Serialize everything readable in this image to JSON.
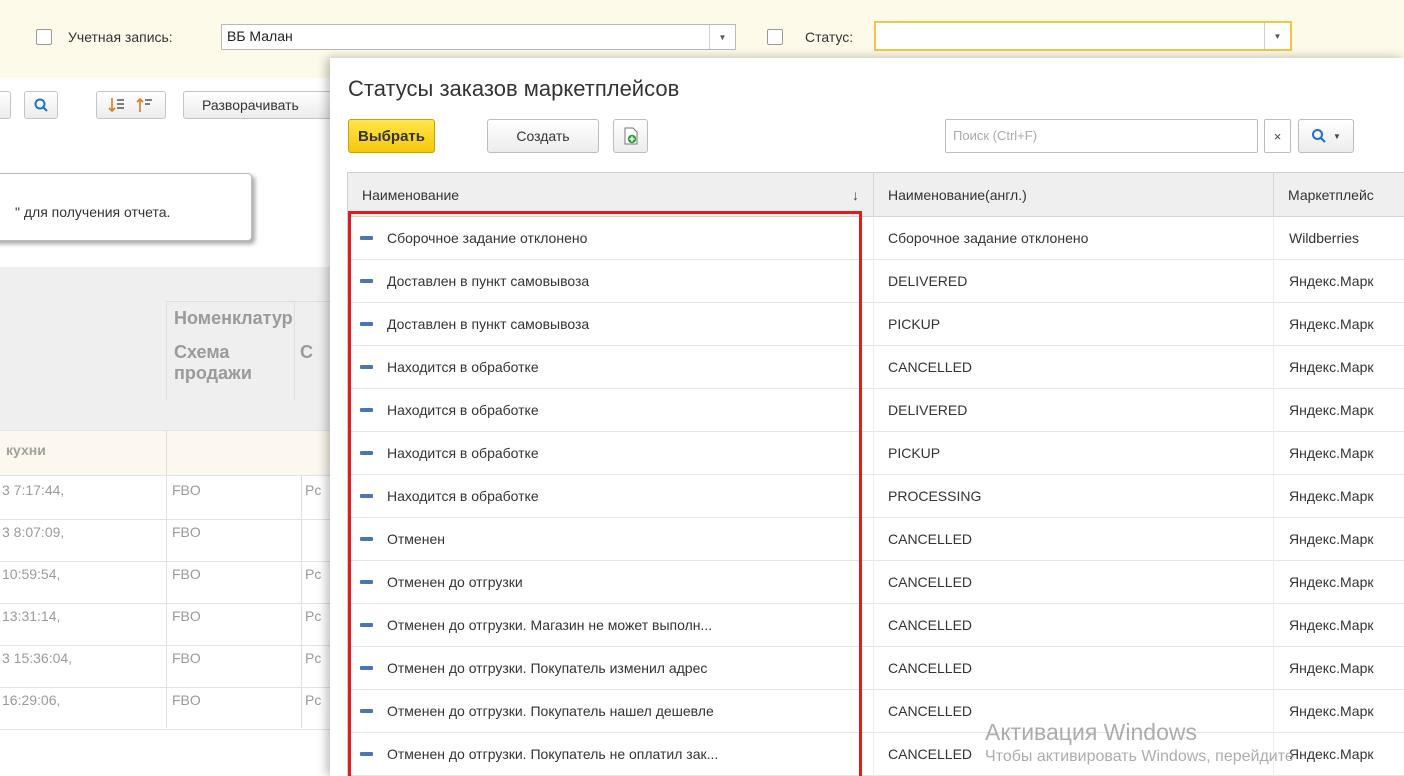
{
  "filter": {
    "account_label": "Учетная запись:",
    "account_value": "ВБ Малан",
    "status_label": "Статус:",
    "status_value": ""
  },
  "bg_toolbar": {
    "expand_label": "Разворачивать"
  },
  "bg_tooltip": "\" для получения отчета.",
  "bg_grid": {
    "header_group": "Номенклатур",
    "header_sub": "Схема продажи",
    "header_sub_next": "С",
    "group_row": "кухни",
    "rows": [
      {
        "date": "3 7:17:44,",
        "scheme": "FBO",
        "extra": "Pc"
      },
      {
        "date": "3 8:07:09,",
        "scheme": "FBO",
        "extra": ""
      },
      {
        "date": "10:59:54,",
        "scheme": "FBO",
        "extra": "Pc"
      },
      {
        "date": "13:31:14,",
        "scheme": "FBO",
        "extra": "Pc"
      },
      {
        "date": "3 15:36:04,",
        "scheme": "FBO",
        "extra": "Pc"
      },
      {
        "date": "16:29:06,",
        "scheme": "FBO",
        "extra": "Pc"
      }
    ]
  },
  "dialog": {
    "title": "Статусы заказов маркетплейсов",
    "select_label": "Выбрать",
    "create_label": "Создать",
    "search_placeholder": "Поиск (Ctrl+F)",
    "search_clear": "×",
    "columns": [
      "Наименование",
      "Наименование(англ.)",
      "Маркетплейс"
    ],
    "sort_indicator": "↓",
    "rows": [
      {
        "name": "Сборочное задание отклонено",
        "name_en": "Сборочное задание отклонено",
        "market": "Wildberries"
      },
      {
        "name": "Доставлен в пункт самовывоза",
        "name_en": "DELIVERED",
        "market": "Яндекс.Марк"
      },
      {
        "name": "Доставлен в пункт самовывоза",
        "name_en": "PICKUP",
        "market": "Яндекс.Марк"
      },
      {
        "name": "Находится в обработке",
        "name_en": "CANCELLED",
        "market": "Яндекс.Марк"
      },
      {
        "name": "Находится в обработке",
        "name_en": "DELIVERED",
        "market": "Яндекс.Марк"
      },
      {
        "name": "Находится в обработке",
        "name_en": "PICKUP",
        "market": "Яндекс.Марк"
      },
      {
        "name": "Находится в обработке",
        "name_en": "PROCESSING",
        "market": "Яндекс.Марк"
      },
      {
        "name": "Отменен",
        "name_en": "CANCELLED",
        "market": "Яндекс.Марк"
      },
      {
        "name": "Отменен до отгрузки",
        "name_en": "CANCELLED",
        "market": "Яндекс.Марк"
      },
      {
        "name": "Отменен до отгрузки. Магазин не может выполн...",
        "name_en": "CANCELLED",
        "market": "Яндекс.Марк"
      },
      {
        "name": "Отменен до отгрузки. Покупатель изменил адрес",
        "name_en": "CANCELLED",
        "market": "Яндекс.Марк"
      },
      {
        "name": "Отменен до отгрузки. Покупатель нашел дешевле",
        "name_en": "CANCELLED",
        "market": "Яндекс.Марк"
      },
      {
        "name": "Отменен до отгрузки. Покупатель не оплатил зак...",
        "name_en": "CANCELLED",
        "market": "Яндекс.Марк"
      }
    ]
  },
  "watermark": {
    "line1": "Активация Windows",
    "line2": "Чтобы активировать Windows, перейдите"
  },
  "colors": {
    "primary_button": "#f6c60b",
    "highlight": "#e21b1b",
    "row_marker": "#4a76b3",
    "filter_bg": "#fdfae9"
  }
}
